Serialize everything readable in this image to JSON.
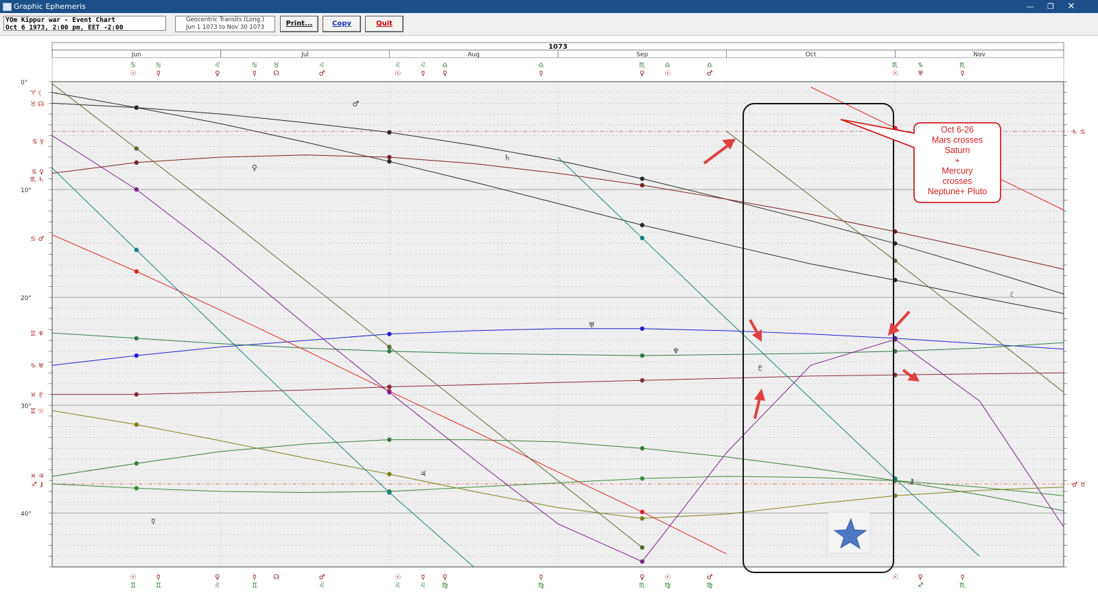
{
  "window": {
    "title": "Graphic Ephemeris"
  },
  "toolbar": {
    "chart_line1": "YOm Kippur war - Event Chart",
    "chart_line2": "Oct 6 1973, 2:00 pm, EET -2:00",
    "transits_line1": "Geocentric Transits (Long.)",
    "transits_line2": "Jun 1 1073 to Nov 30 1073",
    "print_label": "Print...",
    "copy_label": "Copy",
    "quit_label": "Quit"
  },
  "nav": {
    "prev_label": "<<",
    "next_label": ">>"
  },
  "chart_data": {
    "type": "line",
    "title": "1073",
    "months": [
      "Jun",
      "Jul",
      "Aug",
      "Sep",
      "Oct",
      "Nov"
    ],
    "y_tick_labels": [
      "0°",
      "10°",
      "20°",
      "30°",
      "40°"
    ],
    "ylim": [
      0,
      45
    ],
    "grid": true,
    "y_inverted": true,
    "colors": {
      "moon": "#2a2a2a",
      "node": "#2a2a2a",
      "sun": "#7f7f1a",
      "mercury": "#7a1f8a",
      "venus": "#10807f",
      "mars": "#e02020",
      "jupiter": "#3a7a3a",
      "saturn": "#7a2020",
      "uranus": "#2020d0",
      "neptune": "#2e7a4a",
      "pluto": "#8a2a3a",
      "chiron": "#3a8a3a",
      "asteroid": "#556b2f"
    },
    "series": [
      {
        "name": "Moon",
        "color": "#2a2a2a",
        "x": [
          0,
          0.5,
          1,
          1.5,
          2,
          2.5,
          3,
          3.5,
          4,
          4.5,
          5,
          5.5,
          6
        ],
        "y": [
          1,
          2.4,
          3.9,
          5.6,
          7.4,
          9.3,
          11.3,
          13.3,
          15.1,
          16.9,
          18.4,
          20,
          21.5
        ]
      },
      {
        "name": "Node",
        "color": "#2a2a2a",
        "x": [
          0,
          0.5,
          1,
          1.5,
          2,
          2.5,
          3,
          3.5,
          4,
          4.5,
          5,
          5.5,
          6
        ],
        "y": [
          2,
          2.4,
          3,
          3.8,
          4.7,
          5.9,
          7.3,
          9,
          10.9,
          12.9,
          15,
          17.3,
          19.7
        ]
      },
      {
        "name": "Saturn",
        "color": "#7a2020",
        "x": [
          0,
          0.5,
          1,
          1.5,
          2,
          2.5,
          3,
          3.5,
          4,
          4.5,
          5,
          5.5,
          6
        ],
        "y": [
          8.5,
          7.5,
          7,
          6.8,
          7,
          7.6,
          8.5,
          9.6,
          10.9,
          12.3,
          13.9,
          15.6,
          17.4
        ]
      },
      {
        "name": "Uranus",
        "color": "#2020d0",
        "x": [
          0,
          0.5,
          1,
          1.5,
          2,
          2.5,
          3,
          3.5,
          4,
          4.5,
          5,
          5.5,
          6
        ],
        "y": [
          26.3,
          25.4,
          24.6,
          24,
          23.4,
          23.1,
          22.9,
          22.9,
          23.1,
          23.4,
          23.8,
          24.3,
          24.8
        ]
      },
      {
        "name": "Neptune",
        "color": "#2e7a4a",
        "x": [
          0,
          0.5,
          1,
          1.5,
          2,
          2.5,
          3,
          3.5,
          4,
          4.5,
          5,
          5.5,
          6
        ],
        "y": [
          23.3,
          23.8,
          24.3,
          24.7,
          25,
          25.2,
          25.3,
          25.4,
          25.3,
          25.2,
          25,
          24.7,
          24.2
        ]
      },
      {
        "name": "Pluto",
        "color": "#8a2a3a",
        "x": [
          0,
          0.5,
          1,
          1.5,
          2,
          2.5,
          3,
          3.5,
          4,
          4.5,
          5,
          5.5,
          6
        ],
        "y": [
          29,
          29,
          28.8,
          28.6,
          28.3,
          28.1,
          27.9,
          27.7,
          27.5,
          27.3,
          27.2,
          27.1,
          27
        ]
      },
      {
        "name": "Jupiter",
        "color": "#3a7a3a",
        "x": [
          0,
          0.5,
          1,
          1.5,
          2,
          2.5,
          3,
          3.5,
          4,
          4.5,
          5,
          5.5,
          6
        ],
        "y": [
          36.6,
          35.4,
          34.3,
          33.6,
          33.2,
          33.2,
          33.4,
          34,
          34.8,
          35.8,
          37,
          38.3,
          39.8
        ]
      },
      {
        "name": "Chiron",
        "color": "#3a8a3a",
        "x": [
          0,
          0.5,
          1,
          1.5,
          2,
          2.5,
          3,
          3.5,
          4,
          4.5,
          5,
          5.5,
          6
        ],
        "y": [
          37.3,
          37.7,
          38,
          38.1,
          38,
          37.6,
          37.2,
          36.8,
          36.6,
          36.7,
          37,
          37.6,
          38.4
        ]
      },
      {
        "name": "Sun",
        "color": "#7f7f1a",
        "x": [
          0,
          0.5,
          1,
          1.5,
          2,
          2.5,
          3,
          3.5,
          4,
          4.5,
          5,
          5.5,
          6
        ],
        "y": [
          30.5,
          31.8,
          33.3,
          34.9,
          36.4,
          38,
          39.5,
          40.5,
          40.1,
          39.2,
          38.4,
          37.9,
          37.6
        ]
      },
      {
        "name": "Mars",
        "color": "#e02020",
        "x": [
          0,
          0.5,
          1,
          1.5,
          2,
          2.5,
          3,
          3.5,
          4,
          4.5,
          5,
          5.5,
          6
        ],
        "y": [
          14.2,
          17.6,
          21.2,
          24.9,
          28.7,
          32.4,
          36.2,
          39.9,
          43.8,
          0.5,
          4.3,
          8.1,
          11.9
        ]
      },
      {
        "name": "Mercury",
        "color": "#7a1f8a",
        "x": [
          0,
          0.5,
          1,
          1.5,
          2,
          2.5,
          3,
          3.5,
          4,
          4.5,
          5,
          5.5,
          6
        ],
        "y": [
          5,
          10,
          16,
          22.5,
          28.8,
          35,
          41,
          44.5,
          34.4,
          26.3,
          23.9,
          29.6,
          41.3
        ]
      },
      {
        "name": "Venus",
        "color": "#10807f",
        "x": [
          0,
          0.5,
          1,
          1.5,
          2,
          2.5,
          3,
          3.5,
          4,
          4.5,
          5,
          5.5,
          6
        ],
        "y": [
          8,
          15.6,
          23.2,
          30.7,
          38.1,
          45,
          7,
          14.5,
          22,
          29.4,
          36.8,
          44,
          6.6
        ]
      },
      {
        "name": "Asteroid",
        "color": "#556b2f",
        "x": [
          0,
          0.5,
          1,
          1.5,
          2,
          2.5,
          3,
          3.5,
          4,
          4.5,
          5,
          5.5,
          6
        ],
        "y": [
          0.2,
          6.2,
          12.2,
          18.4,
          24.6,
          30.8,
          37,
          43.2,
          4.6,
          10.6,
          16.6,
          22.7,
          28.8
        ]
      }
    ],
    "left_sign_labels": [
      {
        "y": 1,
        "text": "♈ ☾"
      },
      {
        "y": 2,
        "text": "♉ ☊"
      },
      {
        "y": 5.5,
        "text": "♋ ☿"
      },
      {
        "y": 8.3,
        "text": "♋ ♀"
      },
      {
        "y": 9,
        "text": "♏ ♄"
      },
      {
        "y": 14.5,
        "text": "♋ ♂"
      },
      {
        "y": 23.3,
        "text": "♊ ♆"
      },
      {
        "y": 26.3,
        "text": "♑ ♅"
      },
      {
        "y": 29,
        "text": "♓ ♇"
      },
      {
        "y": 30.5,
        "text": "♊ ☉"
      },
      {
        "y": 36.5,
        "text": "♓ ♃"
      },
      {
        "y": 37.3,
        "text": "♐ ⚷"
      }
    ],
    "right_sign_labels": [
      {
        "y": 4.6,
        "text": "♄ ♋"
      },
      {
        "y": 37.3,
        "text": "♂ ♉"
      }
    ],
    "curve_labels": [
      {
        "x": 3.2,
        "y": 22.8,
        "text": "♅"
      },
      {
        "x": 3.7,
        "y": 25.2,
        "text": "♆"
      },
      {
        "x": 4.2,
        "y": 26.8,
        "text": "♇"
      },
      {
        "x": 2.7,
        "y": 7.3,
        "text": "♄"
      },
      {
        "x": 1.8,
        "y": 2.3,
        "text": "♂"
      },
      {
        "x": 5.7,
        "y": 20,
        "text": "☾"
      },
      {
        "x": 0.6,
        "y": 41,
        "text": "☿"
      },
      {
        "x": 2.2,
        "y": 36.6,
        "text": "♃"
      },
      {
        "x": 5.1,
        "y": 37.3,
        "text": "⚷"
      },
      {
        "x": 1.2,
        "y": 8.2,
        "text": "♀"
      }
    ],
    "top_labels": [
      {
        "x": 0.48,
        "top": "♋",
        "bottom": "☉"
      },
      {
        "x": 0.63,
        "top": "♋",
        "bottom": "☿"
      },
      {
        "x": 0.98,
        "top": "♌",
        "bottom": "♀"
      },
      {
        "x": 1.2,
        "top": "♋",
        "bottom": "☿"
      },
      {
        "x": 1.33,
        "top": "♉",
        "bottom": "☊"
      },
      {
        "x": 1.6,
        "top": "♌",
        "bottom": "♂"
      },
      {
        "x": 2.05,
        "top": "♌",
        "bottom": "☉"
      },
      {
        "x": 2.2,
        "top": "♌",
        "bottom": "☿"
      },
      {
        "x": 2.33,
        "top": "♎",
        "bottom": "♀"
      },
      {
        "x": 2.9,
        "top": "♎",
        "bottom": "☿"
      },
      {
        "x": 3.5,
        "top": "♏",
        "bottom": "♀"
      },
      {
        "x": 3.65,
        "top": "♎",
        "bottom": "☉"
      },
      {
        "x": 3.9,
        "top": "♎",
        "bottom": "♂"
      },
      {
        "x": 5,
        "top": "♏",
        "bottom": "☉"
      },
      {
        "x": 5.15,
        "top": "♑",
        "bottom": "♅"
      },
      {
        "x": 5.4,
        "top": "♏",
        "bottom": "☿"
      }
    ],
    "bottom_labels": [
      {
        "x": 0.48,
        "top": "☉",
        "bottom": "♊"
      },
      {
        "x": 0.63,
        "top": "☿",
        "bottom": "♊"
      },
      {
        "x": 0.98,
        "top": "♀",
        "bottom": "♌"
      },
      {
        "x": 1.2,
        "top": "☿",
        "bottom": "♊"
      },
      {
        "x": 1.33,
        "top": "☊",
        "bottom": ""
      },
      {
        "x": 1.6,
        "top": "♂",
        "bottom": "♌"
      },
      {
        "x": 2.05,
        "top": "☉",
        "bottom": "♌"
      },
      {
        "x": 2.2,
        "top": "☿",
        "bottom": "♌"
      },
      {
        "x": 2.33,
        "top": "♀",
        "bottom": "♍"
      },
      {
        "x": 2.9,
        "top": "☿",
        "bottom": "♍"
      },
      {
        "x": 3.5,
        "top": "♀",
        "bottom": "♏"
      },
      {
        "x": 3.65,
        "top": "☉",
        "bottom": "♍"
      },
      {
        "x": 3.9,
        "top": "♂",
        "bottom": "♍"
      },
      {
        "x": 5,
        "top": "☉",
        "bottom": ""
      },
      {
        "x": 5.15,
        "top": "♀",
        "bottom": "♐"
      },
      {
        "x": 5.4,
        "top": "☿",
        "bottom": "♏"
      }
    ]
  },
  "callout": {
    "lines": [
      "Oct 6-26",
      "Mars crosses",
      "Saturn",
      "+",
      "Mercury",
      "crosses",
      "Neptune+ Pluto"
    ]
  }
}
